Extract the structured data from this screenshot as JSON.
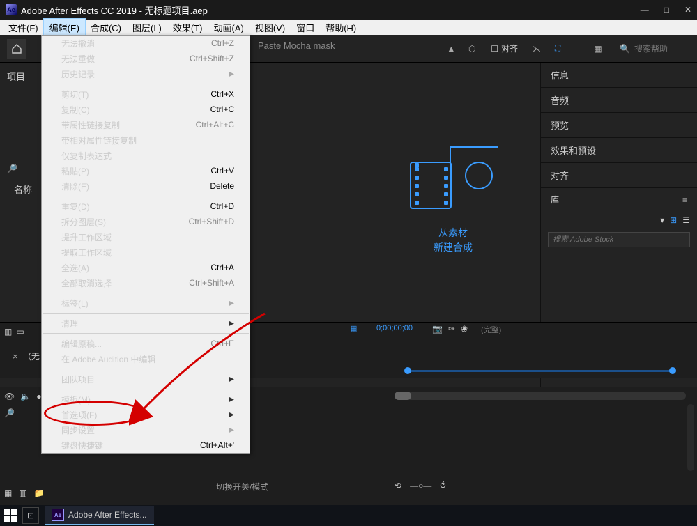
{
  "titlebar": {
    "app_icon_text": "Ae",
    "title": "Adobe After Effects CC 2019 - 无标题项目.aep"
  },
  "menubar": {
    "items": [
      "文件(F)",
      "编辑(E)",
      "合成(C)",
      "图层(L)",
      "效果(T)",
      "动画(A)",
      "视图(V)",
      "窗口",
      "帮助(H)"
    ],
    "active_index": 1
  },
  "toolbar": {
    "align_label": "对齐",
    "search_placeholder": "搜索帮助"
  },
  "dropdown": {
    "paste_mocha_label": "Paste Mocha mask",
    "rows": [
      {
        "label": "无法撤消",
        "shortcut": "Ctrl+Z",
        "disabled": true
      },
      {
        "label": "无法重做",
        "shortcut": "Ctrl+Shift+Z",
        "disabled": true
      },
      {
        "label": "历史记录",
        "submenu": true,
        "disabled": true
      },
      {
        "sep": true
      },
      {
        "label": "剪切(T)",
        "shortcut": "Ctrl+X"
      },
      {
        "label": "复制(C)",
        "shortcut": "Ctrl+C"
      },
      {
        "label": "带属性链接复制",
        "shortcut": "Ctrl+Alt+C",
        "disabled": true
      },
      {
        "label": "带相对属性链接复制",
        "disabled": true
      },
      {
        "label": "仅复制表达式",
        "disabled": true
      },
      {
        "label": "粘贴(P)",
        "shortcut": "Ctrl+V"
      },
      {
        "label": "清除(E)",
        "shortcut": "Delete"
      },
      {
        "sep": true
      },
      {
        "label": "重复(D)",
        "shortcut": "Ctrl+D"
      },
      {
        "label": "拆分图层(S)",
        "shortcut": "Ctrl+Shift+D",
        "disabled": true
      },
      {
        "label": "提升工作区域",
        "disabled": true
      },
      {
        "label": "提取工作区域",
        "disabled": true
      },
      {
        "label": "全选(A)",
        "shortcut": "Ctrl+A"
      },
      {
        "label": "全部取消选择",
        "shortcut": "Ctrl+Shift+A",
        "disabled": true
      },
      {
        "sep": true
      },
      {
        "label": "标签(L)",
        "submenu": true,
        "disabled": true
      },
      {
        "sep": true
      },
      {
        "label": "清理",
        "submenu": true
      },
      {
        "sep": true
      },
      {
        "label": "编辑原稿...",
        "shortcut": "Ctrl+E",
        "disabled": true
      },
      {
        "label": "在 Adobe Audition 中编辑",
        "disabled": true
      },
      {
        "sep": true
      },
      {
        "label": "团队项目",
        "submenu": true
      },
      {
        "sep": true
      },
      {
        "label": "模板(M)",
        "submenu": true
      },
      {
        "label": "首选项(F)",
        "submenu": true,
        "highlight": true
      },
      {
        "label": "同步设置",
        "submenu": true,
        "disabled": true
      },
      {
        "label": "键盘快捷键",
        "shortcut": "Ctrl+Alt+'"
      }
    ]
  },
  "left": {
    "project_label": "项目",
    "name_col": "名称"
  },
  "right": {
    "sections": [
      "信息",
      "音频",
      "预览",
      "效果和预设",
      "对齐"
    ],
    "library_label": "库",
    "stock_placeholder": "搜索 Adobe Stock"
  },
  "center": {
    "placeholder_line1": "从素材",
    "placeholder_line2": "新建合成",
    "timecode": "0;00;00;00",
    "status_word": "(完整)"
  },
  "timeline": {
    "tab_label": "（无",
    "col_label": "切换开关/模式"
  },
  "taskbar": {
    "app_label": "Adobe After Effects..."
  }
}
